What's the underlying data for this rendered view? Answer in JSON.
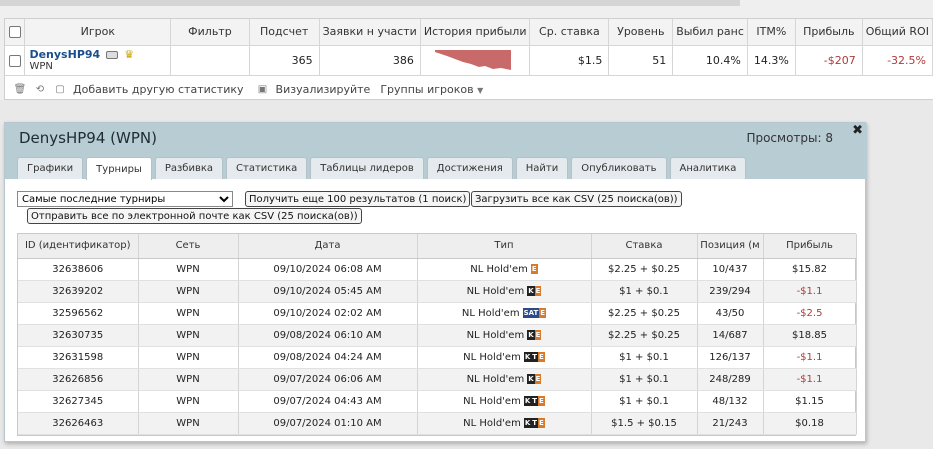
{
  "stats": {
    "headers": [
      "Игрок",
      "Фильтр",
      "Подсчет",
      "Заявки н участи",
      "История прибыли",
      "Ср. ставка",
      "Уровень",
      "Выбил ранс",
      "ITM%",
      "Прибыль",
      "Общий ROI"
    ],
    "row": {
      "player": "DenysHP94",
      "network": "WPN",
      "filter": "",
      "count": "365",
      "entries": "386",
      "avg_stake": "$1.5",
      "level": "51",
      "early_exit": "10.4%",
      "itm": "14.3%",
      "profit": "-$207",
      "roi": "-32.5%"
    },
    "profit_history_color": "#c96a6a",
    "toolbar": {
      "add_stat": "Добавить другую статистику",
      "visualize": "Визуализируйте",
      "groups": "Группы игроков"
    }
  },
  "dialog": {
    "title": "DenysHP94 (WPN)",
    "views": "Просмотры: 8",
    "tabs": [
      "Графики",
      "Турниры",
      "Разбивка",
      "Статистика",
      "Таблицы лидеров",
      "Достижения",
      "Найти",
      "Опубликовать",
      "Аналитика"
    ],
    "active_tab": "Турниры",
    "select_value": "Самые последние турниры",
    "btn_more": "Получить еще 100 результатов (1 поиск)",
    "btn_csv": "Загрузить все как CSV (25 поиска(ов))",
    "btn_email": "Отправить все по электронной почте как CSV (25 поиска(ов))",
    "columns": [
      "ID (идентификатор)",
      "Сеть",
      "Дата",
      "Тип",
      "Ставка",
      "Позиция (м",
      "Прибыль"
    ],
    "rows": [
      {
        "id": "32638606",
        "net": "WPN",
        "date": "09/10/2024 06:08 AM",
        "type": "NL Hold'em",
        "badges": [
          "E"
        ],
        "stake": "$2.25 + $0.25",
        "pos": "10/437",
        "profit": "$15.82",
        "neg": false
      },
      {
        "id": "32639202",
        "net": "WPN",
        "date": "09/10/2024 05:45 AM",
        "type": "NL Hold'em",
        "badges": [
          "K",
          "E"
        ],
        "stake": "$1 + $0.1",
        "pos": "239/294",
        "profit": "-$1.1",
        "neg": true
      },
      {
        "id": "32596562",
        "net": "WPN",
        "date": "09/10/2024 02:02 AM",
        "type": "NL Hold'em",
        "badges": [
          "SAT",
          "E"
        ],
        "stake": "$2.25 + $0.25",
        "pos": "43/50",
        "profit": "-$2.5",
        "neg": true
      },
      {
        "id": "32630735",
        "net": "WPN",
        "date": "09/08/2024 06:10 AM",
        "type": "NL Hold'em",
        "badges": [
          "K",
          "E"
        ],
        "stake": "$2.25 + $0.25",
        "pos": "14/687",
        "profit": "$18.85",
        "neg": false
      },
      {
        "id": "32631598",
        "net": "WPN",
        "date": "09/08/2024 04:24 AM",
        "type": "NL Hold'em",
        "badges": [
          "K",
          "T",
          "E"
        ],
        "stake": "$1 + $0.1",
        "pos": "126/137",
        "profit": "-$1.1",
        "neg": true
      },
      {
        "id": "32626856",
        "net": "WPN",
        "date": "09/07/2024 06:06 AM",
        "type": "NL Hold'em",
        "badges": [
          "K",
          "E"
        ],
        "stake": "$1 + $0.1",
        "pos": "248/289",
        "profit": "-$1.1",
        "neg": true
      },
      {
        "id": "32627345",
        "net": "WPN",
        "date": "09/07/2024 04:43 AM",
        "type": "NL Hold'em",
        "badges": [
          "K",
          "T",
          "E"
        ],
        "stake": "$1 + $0.1",
        "pos": "48/132",
        "profit": "$1.15",
        "neg": false
      },
      {
        "id": "32626463",
        "net": "WPN",
        "date": "09/07/2024 01:10 AM",
        "type": "NL Hold'em",
        "badges": [
          "K",
          "T",
          "E"
        ],
        "stake": "$1.5 + $0.15",
        "pos": "21/243",
        "profit": "$0.18",
        "neg": false
      }
    ]
  }
}
